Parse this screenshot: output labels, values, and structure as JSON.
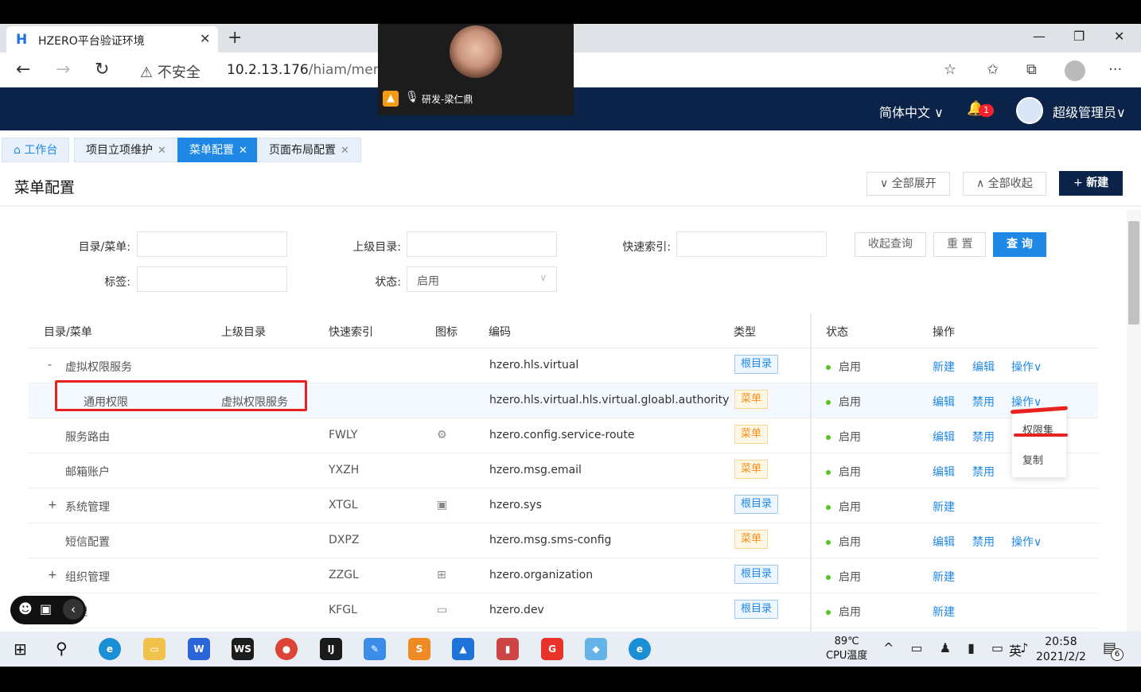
{
  "browser": {
    "tab_title": "HZERO平台验证环境",
    "tab_logo": "H",
    "url_insecure": "不安全",
    "url_host": "10.2.13.176",
    "url_path": "/hiam/menu"
  },
  "video_overlay": {
    "speaker": "研发-梁仁鼎"
  },
  "app_header": {
    "language": "简体中文 ∨",
    "notification_count": "1",
    "user": "超级管理员∨"
  },
  "page_tabs": [
    {
      "label": "工作台"
    },
    {
      "label": "项目立项维护"
    },
    {
      "label": "菜单配置"
    },
    {
      "label": "页面布局配置"
    }
  ],
  "page": {
    "title": "菜单配置",
    "expand_all": "全部展开",
    "collapse_all": "全部收起",
    "new": "新建"
  },
  "search": {
    "label_dir": "目录/菜单:",
    "label_parent": "上级目录:",
    "label_quick": "快速索引:",
    "label_tag": "标签:",
    "label_status": "状态:",
    "status_value": "启用",
    "btn_collapse": "收起查询",
    "btn_reset": "重 置",
    "btn_query": "查 询"
  },
  "table": {
    "columns": [
      "目录/菜单",
      "上级目录",
      "快速索引",
      "图标",
      "编码",
      "类型",
      "状态",
      "操作"
    ],
    "rows": [
      {
        "expander": "-",
        "name": "虚拟权限服务",
        "parent": "",
        "quick": "",
        "icon": "",
        "code": "hzero.hls.virtual",
        "type": "根目录",
        "status": "启用",
        "a1": "新建",
        "a2": "编辑",
        "a3": "操作∨"
      },
      {
        "expander": "",
        "name": "通用权限",
        "parent": "虚拟权限服务",
        "quick": "",
        "icon": "",
        "code": "hzero.hls.virtual.hls.virtual.gloabl.authority",
        "type": "菜单",
        "status": "启用",
        "a1": "编辑",
        "a2": "禁用",
        "a3": "操作∨"
      },
      {
        "expander": "",
        "name": "服务路由",
        "parent": "",
        "quick": "FWLY",
        "icon": "⚙",
        "code": "hzero.config.service-route",
        "type": "菜单",
        "status": "启用",
        "a1": "编辑",
        "a2": "禁用",
        "a3": ""
      },
      {
        "expander": "",
        "name": "邮箱账户",
        "parent": "",
        "quick": "YXZH",
        "icon": "",
        "code": "hzero.msg.email",
        "type": "菜单",
        "status": "启用",
        "a1": "编辑",
        "a2": "禁用",
        "a3": ""
      },
      {
        "expander": "+",
        "name": "系统管理",
        "parent": "",
        "quick": "XTGL",
        "icon": "▣",
        "code": "hzero.sys",
        "type": "根目录",
        "status": "启用",
        "a1": "新建",
        "a2": "",
        "a3": ""
      },
      {
        "expander": "",
        "name": "短信配置",
        "parent": "",
        "quick": "DXPZ",
        "icon": "",
        "code": "hzero.msg.sms-config",
        "type": "菜单",
        "status": "启用",
        "a1": "编辑",
        "a2": "禁用",
        "a3": "操作∨"
      },
      {
        "expander": "+",
        "name": "组织管理",
        "parent": "",
        "quick": "ZZGL",
        "icon": "⊞",
        "code": "hzero.organization",
        "type": "根目录",
        "status": "启用",
        "a1": "新建",
        "a2": "",
        "a3": ""
      },
      {
        "expander": "",
        "name": "管理",
        "parent": "",
        "quick": "KFGL",
        "icon": "▭",
        "code": "hzero.dev",
        "type": "根目录",
        "status": "启用",
        "a1": "新建",
        "a2": "",
        "a3": ""
      }
    ],
    "dropdown": [
      "权限集",
      "复制"
    ]
  },
  "taskbar": {
    "cpu_temp": "89℃",
    "cpu_label": "CPU温度",
    "ime": "英",
    "time": "20:58",
    "date": "2021/2/2",
    "notifications": "6"
  }
}
